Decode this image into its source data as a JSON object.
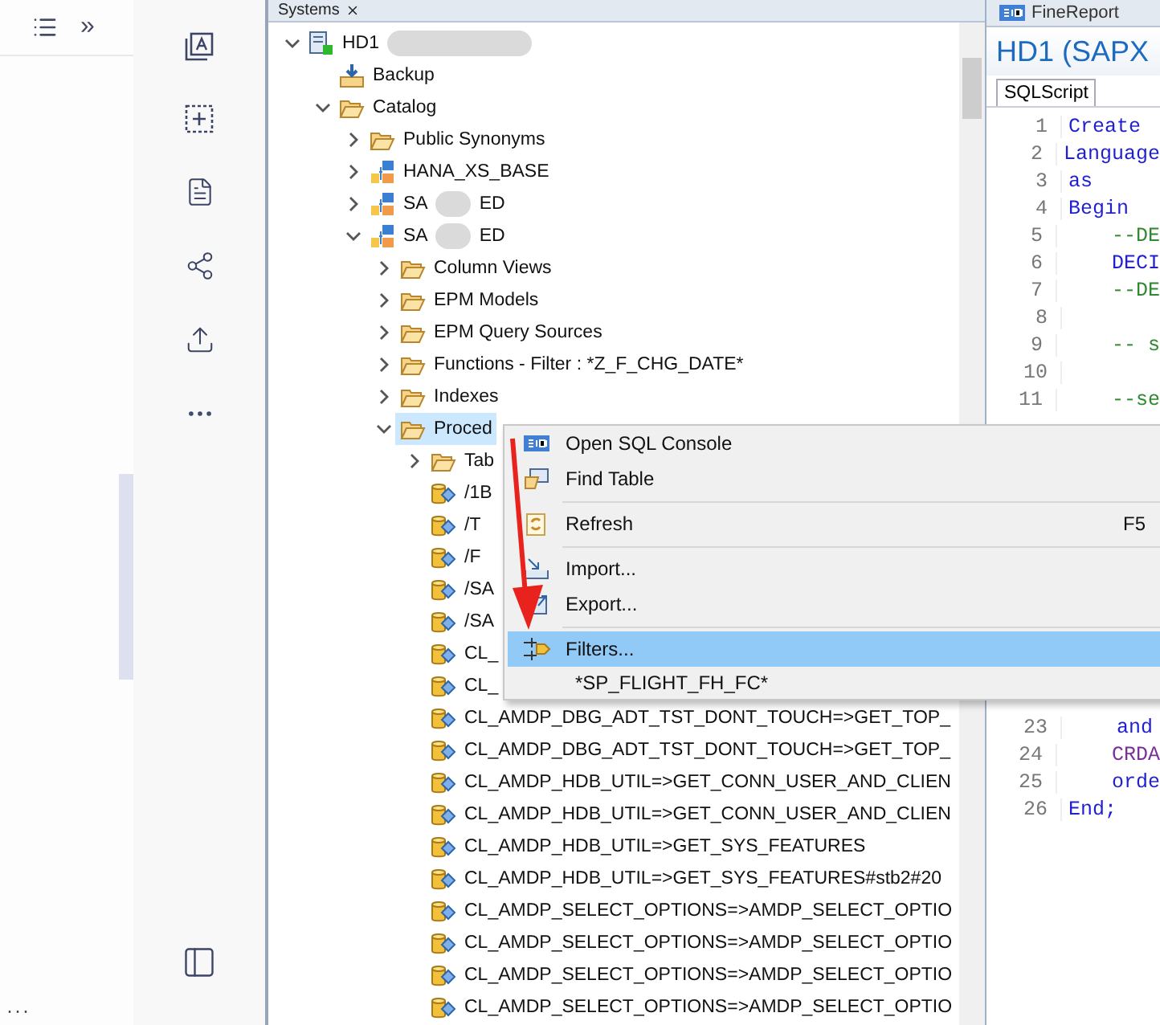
{
  "left_panel": {
    "toolbar": {
      "more": "»"
    },
    "footer": "···"
  },
  "tree": {
    "tab": "Systems",
    "nodes": [
      {
        "label": "HD1",
        "kind": "system",
        "redacted": true,
        "expanded": true,
        "selected": false,
        "children": [
          {
            "label": "Backup",
            "kind": "backup",
            "selected": false
          },
          {
            "label": "Catalog",
            "kind": "folder",
            "expanded": true,
            "selected": false,
            "children": [
              {
                "label": "Public Synonyms",
                "kind": "folder",
                "expanded": false,
                "selected": false
              },
              {
                "label": "HANA_XS_BASE",
                "kind": "schema",
                "expanded": false,
                "selected": false
              },
              {
                "label": "SA",
                "label_after": "ED",
                "redacted": true,
                "kind": "schema",
                "expanded": false,
                "selected": false
              },
              {
                "label": "SA",
                "label_after": "ED",
                "redacted": true,
                "kind": "schema",
                "expanded": true,
                "selected": false,
                "children": [
                  {
                    "label": "Column Views",
                    "kind": "folder",
                    "expanded": false,
                    "selected": false
                  },
                  {
                    "label": "EPM Models",
                    "kind": "folder",
                    "expanded": false,
                    "selected": false
                  },
                  {
                    "label": "EPM Query Sources",
                    "kind": "folder",
                    "expanded": false,
                    "selected": false
                  },
                  {
                    "label": "Functions - Filter : *Z_F_CHG_DATE*",
                    "kind": "folder",
                    "expanded": false,
                    "selected": false
                  },
                  {
                    "label": "Indexes",
                    "kind": "folder",
                    "expanded": false,
                    "selected": false
                  },
                  {
                    "label": "Proced",
                    "kind": "folder",
                    "expanded": true,
                    "selected": true,
                    "children": [
                      {
                        "label": "Tab",
                        "kind": "folder",
                        "expanded": false,
                        "selected": false
                      },
                      {
                        "label": "/1B",
                        "kind": "procedure",
                        "selected": false
                      },
                      {
                        "label": "/T",
                        "kind": "procedure",
                        "selected": false
                      },
                      {
                        "label": "/F",
                        "kind": "procedure",
                        "selected": false
                      },
                      {
                        "label": "/SA",
                        "kind": "procedure",
                        "selected": false
                      },
                      {
                        "label": "/SA",
                        "kind": "procedure",
                        "selected": false
                      },
                      {
                        "label": "CL_",
                        "kind": "procedure",
                        "selected": false
                      },
                      {
                        "label": "CL_",
                        "kind": "procedure",
                        "selected": false
                      },
                      {
                        "label": "CL_AMDP_DBG_ADT_TST_DONT_TOUCH=>GET_TOP_",
                        "kind": "procedure",
                        "selected": false
                      },
                      {
                        "label": "CL_AMDP_DBG_ADT_TST_DONT_TOUCH=>GET_TOP_",
                        "kind": "procedure",
                        "selected": false
                      },
                      {
                        "label": "CL_AMDP_HDB_UTIL=>GET_CONN_USER_AND_CLIEN",
                        "kind": "procedure",
                        "selected": false
                      },
                      {
                        "label": "CL_AMDP_HDB_UTIL=>GET_CONN_USER_AND_CLIEN",
                        "kind": "procedure",
                        "selected": false
                      },
                      {
                        "label": "CL_AMDP_HDB_UTIL=>GET_SYS_FEATURES",
                        "kind": "procedure",
                        "selected": false
                      },
                      {
                        "label": "CL_AMDP_HDB_UTIL=>GET_SYS_FEATURES#stb2#20",
                        "kind": "procedure",
                        "selected": false
                      },
                      {
                        "label": "CL_AMDP_SELECT_OPTIONS=>AMDP_SELECT_OPTIO",
                        "kind": "procedure",
                        "selected": false
                      },
                      {
                        "label": "CL_AMDP_SELECT_OPTIONS=>AMDP_SELECT_OPTIO",
                        "kind": "procedure",
                        "selected": false
                      },
                      {
                        "label": "CL_AMDP_SELECT_OPTIONS=>AMDP_SELECT_OPTIO",
                        "kind": "procedure",
                        "selected": false
                      },
                      {
                        "label": "CL_AMDP_SELECT_OPTIONS=>AMDP_SELECT_OPTIO",
                        "kind": "procedure",
                        "selected": false
                      }
                    ]
                  }
                ]
              }
            ]
          }
        ]
      }
    ]
  },
  "context_menu": [
    {
      "kind": "item",
      "label": "Open SQL Console",
      "selected": false
    },
    {
      "kind": "item",
      "label": "Find Table",
      "selected": false
    },
    {
      "kind": "separator"
    },
    {
      "kind": "item",
      "label": "Refresh",
      "shortcut": "F5",
      "selected": false
    },
    {
      "kind": "separator"
    },
    {
      "kind": "item",
      "label": "Import...",
      "selected": false
    },
    {
      "kind": "item",
      "label": "Export...",
      "selected": false
    },
    {
      "kind": "separator"
    },
    {
      "kind": "item",
      "label": "Filters...",
      "selected": true
    },
    {
      "kind": "note",
      "label": "*SP_FLIGHT_FH_FC*"
    }
  ],
  "editor": {
    "tab": "FineReport",
    "title": "HD1 (SAPX",
    "sub_tab": "SQLScript",
    "lines": [
      {
        "number": "1",
        "text": "Create",
        "kind": "keyword"
      },
      {
        "number": "2",
        "text": "Language",
        "kind": "keyword"
      },
      {
        "number": "3",
        "text": "as",
        "kind": "keyword"
      },
      {
        "number": "4",
        "text": "Begin",
        "kind": "keyword"
      },
      {
        "number": "5",
        "text": "    --DE",
        "kind": "comment"
      },
      {
        "number": "6",
        "text": "    DECI",
        "kind": "keyword"
      },
      {
        "number": "7",
        "text": "    --DE",
        "kind": "comment"
      },
      {
        "number": "8"
      },
      {
        "number": "9",
        "text": "    -- s",
        "kind": "comment"
      },
      {
        "number": "10"
      },
      {
        "number": "11",
        "text": "    --se",
        "kind": "comment"
      },
      {
        "number": "23",
        "text": "    and",
        "kind": "keyword"
      },
      {
        "number": "24",
        "text": "    CRDA",
        "kind": "identifier"
      },
      {
        "number": "25",
        "text": "    orde",
        "kind": "keyword"
      },
      {
        "number": "26",
        "text": "End;",
        "kind": "keyword"
      }
    ]
  }
}
